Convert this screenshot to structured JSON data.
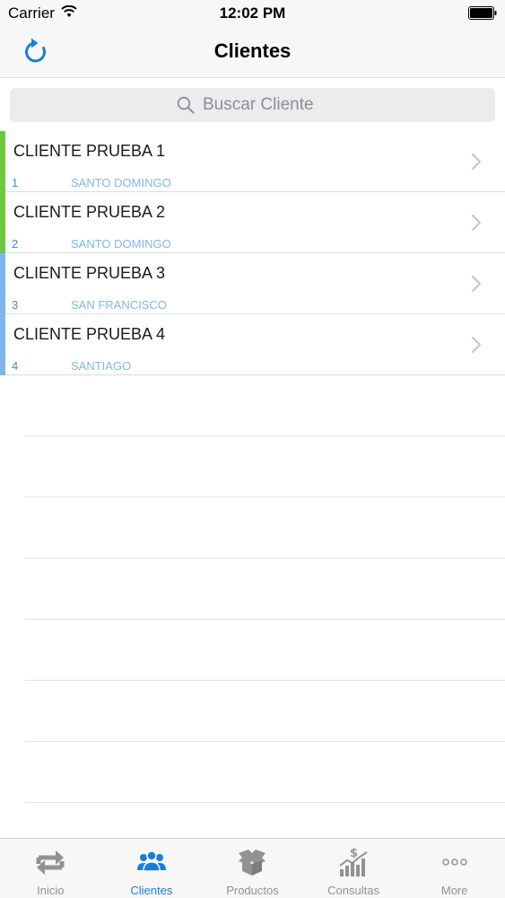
{
  "status_bar": {
    "carrier": "Carrier",
    "time": "12:02 PM"
  },
  "nav": {
    "title": "Clientes"
  },
  "search": {
    "placeholder": "Buscar Cliente"
  },
  "colors": {
    "accent": "#1a7ddb",
    "green_stripe": "#6cc93e",
    "blue_stripe": "#7db5ee"
  },
  "clients": [
    {
      "name": "CLIENTE PRUEBA 1",
      "code": "1",
      "city": "SANTO DOMINGO",
      "stripe": "#6cc93e"
    },
    {
      "name": "CLIENTE PRUEBA 2",
      "code": "2",
      "city": "SANTO DOMINGO",
      "stripe": "#6cc93e"
    },
    {
      "name": "CLIENTE PRUEBA 3",
      "code": "3",
      "city": "SAN FRANCISCO",
      "stripe": "#7db5ee"
    },
    {
      "name": "CLIENTE PRUEBA 4",
      "code": "4",
      "city": "SANTIAGO",
      "stripe": "#7db5ee"
    }
  ],
  "tabs": [
    {
      "label": "Inicio",
      "icon": "swap-arrows-icon",
      "active": false
    },
    {
      "label": "Clientes",
      "icon": "users-icon",
      "active": true
    },
    {
      "label": "Productos",
      "icon": "boxes-icon",
      "active": false
    },
    {
      "label": "Consultas",
      "icon": "chart-dollar-icon",
      "active": false
    },
    {
      "label": "More",
      "icon": "more-dots-icon",
      "active": false
    }
  ]
}
